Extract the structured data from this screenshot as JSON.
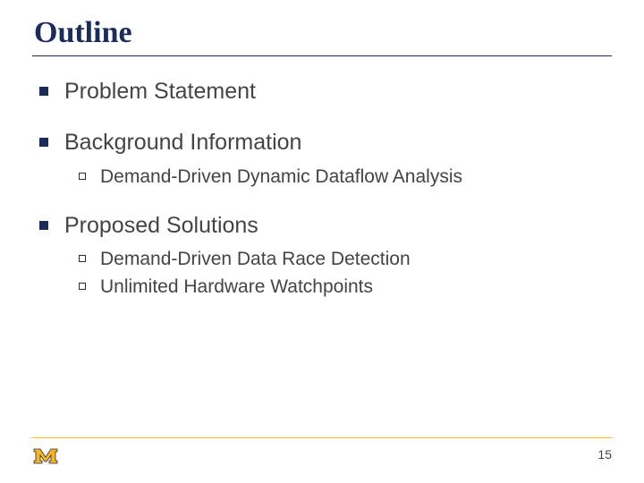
{
  "title": "Outline",
  "items": [
    {
      "label": "Problem Statement",
      "children": []
    },
    {
      "label": "Background Information",
      "children": [
        {
          "label": "Demand-Driven Dynamic Dataflow Analysis"
        }
      ]
    },
    {
      "label": "Proposed Solutions",
      "children": [
        {
          "label": "Demand-Driven Data Race Detection"
        },
        {
          "label": "Unlimited Hardware Watchpoints"
        }
      ]
    }
  ],
  "page_number": "15",
  "colors": {
    "accent_navy": "#1a2c5a",
    "accent_maize": "#fdb515"
  }
}
